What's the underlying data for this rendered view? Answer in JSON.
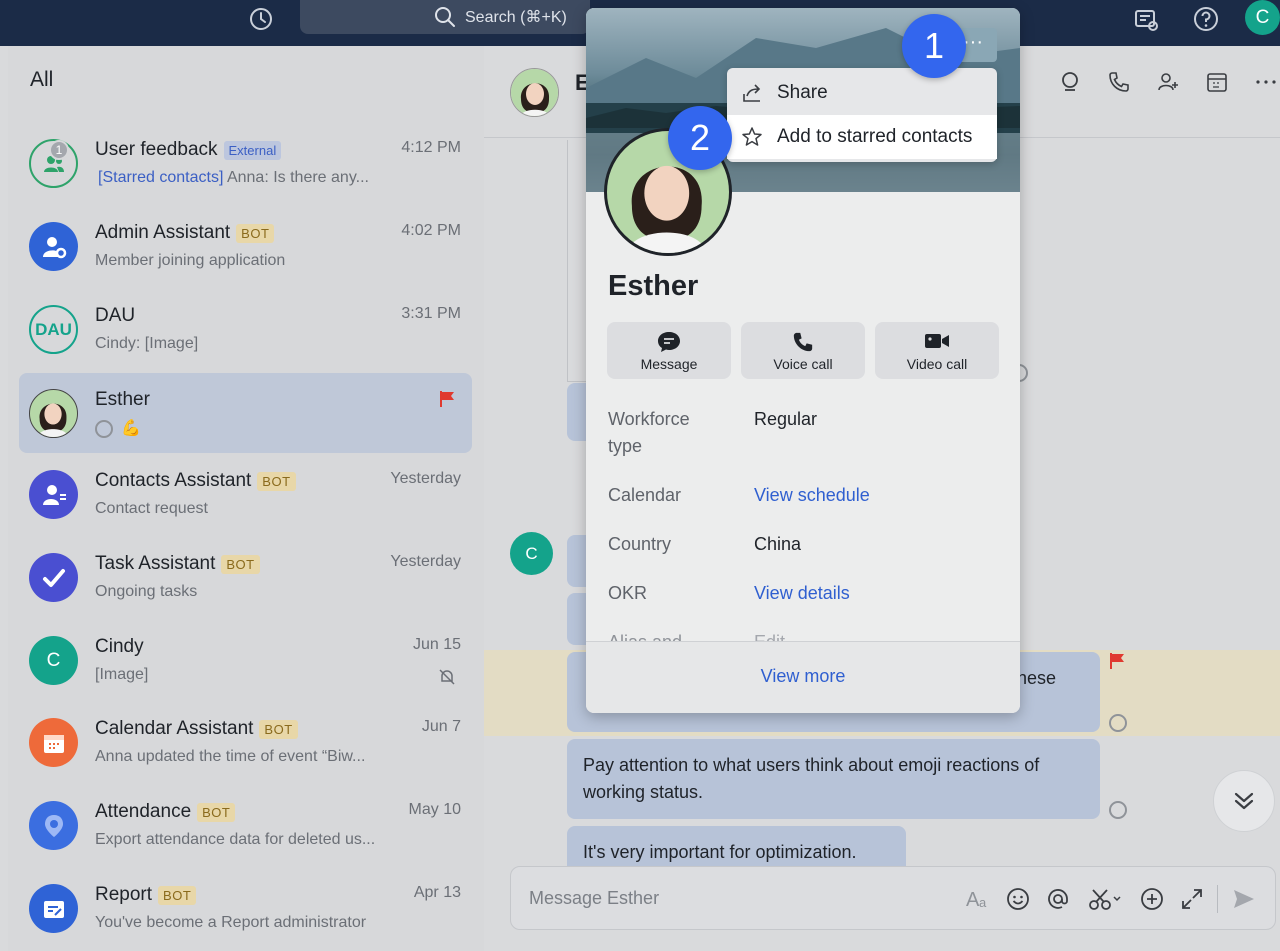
{
  "topbar": {
    "search_text": "Search (⌘+K)",
    "avatar_letter": "C"
  },
  "sidebar": {
    "heading": "All",
    "chats": [
      {
        "name": "User feedback",
        "tag": "External",
        "time": "4:12 PM",
        "preview_prefix": "[Starred contacts]",
        "preview": " Anna: Is there any...",
        "unread": "1",
        "avatar_color": "#d7d8da"
      },
      {
        "name": "Admin Assistant",
        "tag": "BOT",
        "time": "4:02 PM",
        "preview": "Member joining application",
        "avatar_color": "#2f63d6"
      },
      {
        "name": "DAU",
        "tag": "",
        "time": "3:31 PM",
        "preview": "Cindy: [Image]",
        "avatar_text": "DAU",
        "avatar_color": "#d7d8da"
      },
      {
        "name": "Esther",
        "tag": "",
        "time": "",
        "preview": "💪",
        "avatar_color": "#b6d8a8"
      },
      {
        "name": "Contacts Assistant",
        "tag": "BOT",
        "time": "Yesterday",
        "preview": "Contact request",
        "avatar_color": "#4a4fd1"
      },
      {
        "name": "Task Assistant",
        "tag": "BOT",
        "time": "Yesterday",
        "preview": "Ongoing tasks",
        "avatar_color": "#4a4fd1"
      },
      {
        "name": "Cindy",
        "tag": "",
        "time": "Jun 15",
        "preview": "[Image]",
        "avatar_text": "C",
        "avatar_color": "#14a38b"
      },
      {
        "name": "Calendar Assistant",
        "tag": "BOT",
        "time": "Jun 7",
        "preview": "Anna updated the time of event “Biw...",
        "avatar_color": "#ee6a3a"
      },
      {
        "name": "Attendance",
        "tag": "BOT",
        "time": "May 10",
        "preview": "Export attendance data for deleted us...",
        "avatar_color": "#3b6ee0"
      },
      {
        "name": "Report",
        "tag": "BOT",
        "time": "Apr 13",
        "preview": "You've become a Report administrator",
        "avatar_color": "#2f63d6"
      }
    ]
  },
  "chat": {
    "header_initial": "E",
    "other_avatar_letter": "C",
    "bubble_partial": "hese",
    "messages": [
      "Pay attention to what users think about emoji reactions of working status.",
      "It's very important for optimization."
    ],
    "composer_placeholder": "Message Esther"
  },
  "profile_card": {
    "name": "Esther",
    "more_glyph": "···",
    "actions": [
      {
        "label": "Message"
      },
      {
        "label": "Voice call"
      },
      {
        "label": "Video call"
      }
    ],
    "fields": [
      {
        "label": "Workforce type",
        "value": "Regular",
        "link": false
      },
      {
        "label": "Calendar",
        "value": "View schedule",
        "link": true
      },
      {
        "label": "Country",
        "value": "China",
        "link": false
      },
      {
        "label": "OKR",
        "value": "View details",
        "link": true
      },
      {
        "label": "Alias and",
        "value": "Edit",
        "link": false
      }
    ],
    "view_more": "View more"
  },
  "menu": {
    "items": [
      {
        "label": "Share"
      },
      {
        "label": "Add to starred contacts"
      }
    ]
  },
  "steps": [
    "1",
    "2"
  ]
}
